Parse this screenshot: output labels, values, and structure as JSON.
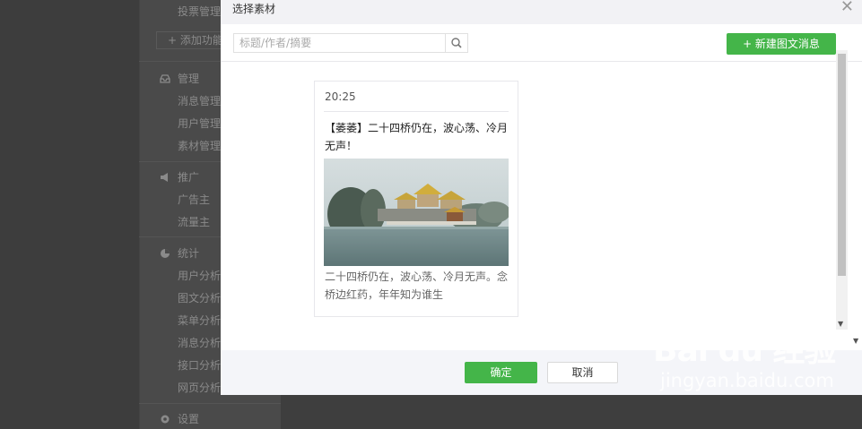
{
  "background": {
    "sidebar": {
      "item_vote": "投票管理",
      "add_feature": "+ 添加功能",
      "group_manage": "管理",
      "item_messages": "消息管理",
      "item_users": "用户管理",
      "item_materials": "素材管理",
      "group_promote": "推广",
      "item_advertiser": "广告主",
      "item_traffic": "流量主",
      "group_stats": "统计",
      "item_user_analysis": "用户分析",
      "item_article_analysis": "图文分析",
      "item_menu_analysis": "菜单分析",
      "item_message_analysis": "消息分析",
      "item_api_analysis": "接口分析",
      "item_web_analysis": "网页分析",
      "group_settings": "设置"
    }
  },
  "dialog": {
    "title": "选择素材",
    "close_icon": "close-icon",
    "search": {
      "placeholder": "标题/作者/摘要",
      "value": "",
      "icon": "search-icon"
    },
    "new_button_label": "+ 新建图文消息",
    "card": {
      "time": "20:25",
      "title": "【萎萎】二十四桥仍在，波心荡、冷月无声！",
      "image": "lake-pavilion-photo",
      "description": "二十四桥仍在，波心荡、冷月无声。念桥边红药，年年知为谁生"
    },
    "ok_label": "确定",
    "cancel_label": "取消"
  },
  "watermark": {
    "logo": "Bai du 经验",
    "url": "jingyan.baidu.com"
  },
  "colors": {
    "accent": "#44b549",
    "overlay": "#3e3e3e"
  }
}
